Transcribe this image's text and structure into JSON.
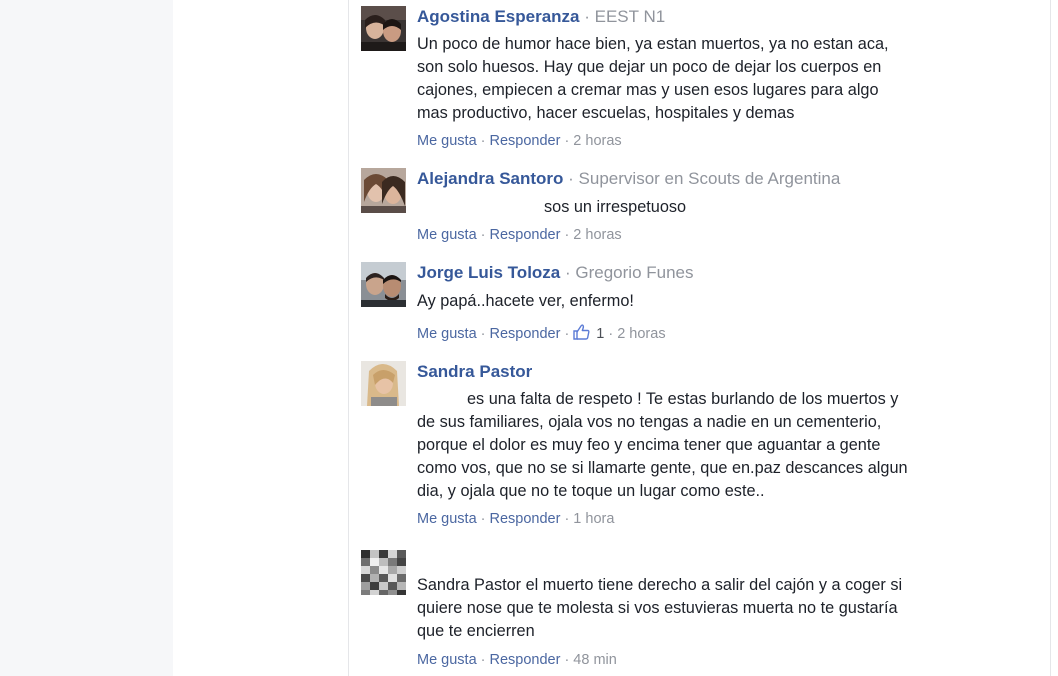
{
  "comments": [
    {
      "author": "Agostina Esperanza",
      "subtitle": "EEST N1",
      "text": "Un poco de humor hace bien, ya estan muertos, ya no estan aca,\nson solo huesos. Hay que dejar un poco de dejar los cuerpos en\ncajones, empiecen a cremar mas y usen esos lugares para algo\nmas productivo, hacer escuelas, hospitales y demas",
      "like_label": "Me gusta",
      "reply_label": "Responder",
      "time": "2 horas"
    },
    {
      "author": "Alejandra Santoro",
      "subtitle": "Supervisor en Scouts de Argentina",
      "text": "sos un irrespetuoso",
      "like_label": "Me gusta",
      "reply_label": "Responder",
      "time": "2 horas"
    },
    {
      "author": "Jorge Luis Toloza",
      "subtitle": "Gregorio Funes",
      "text": "Ay papá..hacete ver, enfermo!",
      "like_label": "Me gusta",
      "reply_label": "Responder",
      "like_count": "1",
      "time": "2 horas"
    },
    {
      "author": "Sandra Pastor",
      "text": "es una falta de respeto ! Te estas burlando de los muertos y\nde sus familiares, ojala vos no tengas a nadie en un cementerio,\nporque el dolor es muy feo y encima tener que aguantar a gente\ncomo vos, que no se si llamarte gente, que en.paz descances algun\ndia, y ojala que no te toque un lugar como este..",
      "like_label": "Me gusta",
      "reply_label": "Responder",
      "time": "1 hora"
    },
    {
      "text": "Sandra Pastor el muerto tiene derecho a salir del cajón y a coger si\nquiere nose que te molesta si vos estuvieras muerta no te gustaría\nque te encierren",
      "like_label": "Me gusta",
      "reply_label": "Responder",
      "time": "48 min"
    }
  ],
  "colors": {
    "author": "#365899",
    "action_link": "#4b67a1",
    "meta": "#90949c",
    "text": "#1d2129",
    "gutter": "#f6f7f9"
  },
  "icons": [
    "like-thumb-icon"
  ]
}
